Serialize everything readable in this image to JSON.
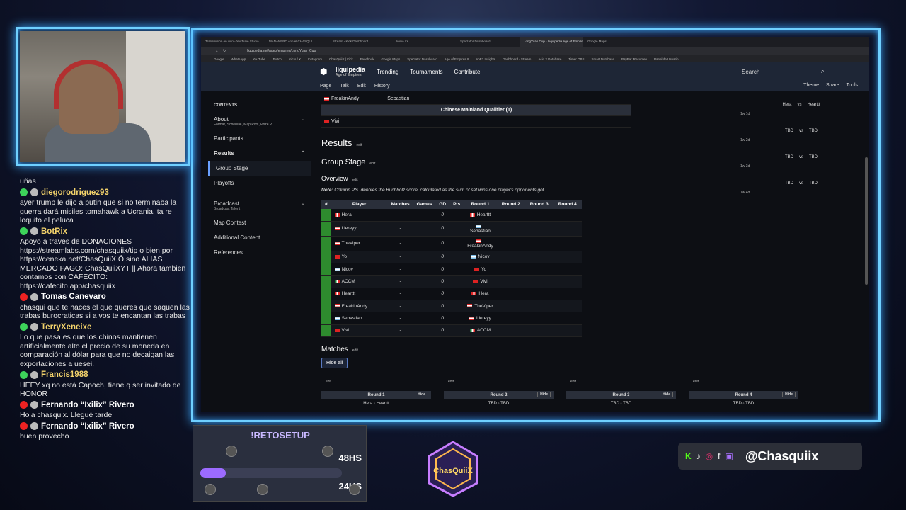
{
  "browser": {
    "tabs": [
      "Transmisión en vivo - YouTube Studio",
      "MAÑANERO con el CHASQUI",
      "Stream - Kick Dashboard",
      "Inicio / X",
      "Spectator Dashboard",
      "LongYuan Cup - Liquipedia Age of Empires",
      "Google Maps"
    ],
    "url": "liquipedia.net/ageofempires/LongYuan_Cup",
    "bookmarks": [
      "Google",
      "WhatsApp",
      "YouTube",
      "Twitch",
      "Inicio / X",
      "Instagram",
      "ChasQuiiX | Kick",
      "Facebook",
      "Google Maps",
      "Spectator Dashboard",
      "Age of Empires II",
      "AoE2 Insights",
      "Dashboard / Stream",
      "Acid 2 Database",
      "Timer OBS",
      "Smart Database",
      "PayPal: Resumen",
      "Panel de Usuario"
    ]
  },
  "liquipedia": {
    "logo": "liquipedia",
    "subtitle": "Age of Empires",
    "menu": [
      "Trending",
      "Tournaments",
      "Contribute"
    ],
    "search": "Search",
    "subnav": [
      "Page",
      "Talk",
      "Edit",
      "History"
    ],
    "subnav_right": [
      "Theme",
      "Share",
      "Tools"
    ]
  },
  "sidebar": {
    "contents": "CONTENTS",
    "about": "About",
    "about_sub": "Format, Schedule, Map Pool, Prize P...",
    "participants": "Participants",
    "results": "Results",
    "group_stage": "Group Stage",
    "playoffs": "Playoffs",
    "broadcast": "Broadcast",
    "broadcast_sub": "Broadcast Talent",
    "map_contest": "Map Contest",
    "additional": "Additional Content",
    "references": "References"
  },
  "qualifier": {
    "row1_player": "FreakinAndy",
    "row1_opp": "Sebastian",
    "title": "Chinese Mainland Qualifier (1)",
    "row2_player": "Vivi"
  },
  "main": {
    "results": "Results",
    "edit": "edit",
    "group_stage": "Group Stage",
    "overview": "Overview",
    "note_bold": "Note:",
    "note_text": " Column Pts. denotes the Buchholz score, calculated as the sum of set wins one player's opponents got.",
    "table_headers": [
      "#",
      "Player",
      "Matches",
      "Games",
      "GD",
      "Pts",
      "Round 1",
      "Round 2",
      "Round 3",
      "Round 4"
    ],
    "matches": "Matches",
    "hide_all": "Hide all"
  },
  "standings": [
    {
      "player": "Hera",
      "flag": "f-pe",
      "matches": "-",
      "gd": "0",
      "r1": "Hearttt",
      "r1flag": "f-pe"
    },
    {
      "player": "Liereyy",
      "flag": "f-at",
      "matches": "-",
      "gd": "0",
      "r1": "Sebastian",
      "r1flag": "f-ar"
    },
    {
      "player": "TheViper",
      "flag": "f-at",
      "matches": "-",
      "gd": "0",
      "r1": "FreakinAndy",
      "r1flag": "f-at"
    },
    {
      "player": "Yo",
      "flag": "f-cn",
      "matches": "-",
      "gd": "0",
      "r1": "Nicov",
      "r1flag": "f-ar"
    },
    {
      "player": "Nicov",
      "flag": "f-ar",
      "matches": "-",
      "gd": "0",
      "r1": "Yo",
      "r1flag": "f-cn"
    },
    {
      "player": "ACCM",
      "flag": "f-mx",
      "matches": "-",
      "gd": "0",
      "r1": "Vivi",
      "r1flag": "f-cn"
    },
    {
      "player": "Hearttt",
      "flag": "f-pe",
      "matches": "-",
      "gd": "0",
      "r1": "Hera",
      "r1flag": "f-pe"
    },
    {
      "player": "FreakinAndy",
      "flag": "f-at",
      "matches": "-",
      "gd": "0",
      "r1": "TheViper",
      "r1flag": "f-at"
    },
    {
      "player": "Sebastian",
      "flag": "f-ar",
      "matches": "-",
      "gd": "0",
      "r1": "Liereyy",
      "r1flag": "f-at"
    },
    {
      "player": "Vivi",
      "flag": "f-cn",
      "matches": "-",
      "gd": "0",
      "r1": "ACCM",
      "r1flag": "f-mx"
    }
  ],
  "rounds": [
    {
      "title": "Round 1",
      "hide": "Hide",
      "left": "Hera",
      "right": "Hearttt"
    },
    {
      "title": "Round 2",
      "hide": "Hide",
      "left": "TBD",
      "right": "TBD"
    },
    {
      "title": "Round 3",
      "hide": "Hide",
      "left": "TBD",
      "right": "TBD"
    },
    {
      "title": "Round 4",
      "hide": "Hide",
      "left": "TBD",
      "right": "TBD"
    }
  ],
  "right_panel": [
    {
      "left": "Hera",
      "vs": "vs",
      "right": "Hearttt",
      "time": "1w 1d"
    },
    {
      "left": "TBD",
      "vs": "vs",
      "right": "TBD",
      "time": "1w 2d"
    },
    {
      "left": "TBD",
      "vs": "vs",
      "right": "TBD",
      "time": "1w 3d"
    },
    {
      "left": "TBD",
      "vs": "vs",
      "right": "TBD",
      "time": "1w 4d"
    }
  ],
  "chat": [
    {
      "type": "text",
      "text": "uñas"
    },
    {
      "type": "user",
      "badge": "b-green",
      "name": "diegorodriguez93"
    },
    {
      "type": "text",
      "text": "ayer trump le dijo a putin que si no terminaba la guerra dará misiles tomahawk a Ucrania, ta re loquito el peluca"
    },
    {
      "type": "user",
      "badge": "b-green",
      "name": "BotRix"
    },
    {
      "type": "text",
      "text": "Apoyo a traves de DONACIONES https://streamlabs.com/chasquiix/tip o bien por https://ceneka.net/ChasQuiiX Ó sino ALIAS MERCADO PAGO: ChasQuiiXYT || Ahora tambien contamos con CAFECITO: https://cafecito.app/chasquiix"
    },
    {
      "type": "user",
      "badge": "b-red",
      "name": "Tomas Canevaro"
    },
    {
      "type": "text",
      "text": "chasqui que te haces el que queres que saquen las trabas burocraticas si a vos te encantan las trabas"
    },
    {
      "type": "user",
      "badge": "b-green",
      "name": "TerryXeneixe"
    },
    {
      "type": "text",
      "text": "Lo que pasa es que los chinos mantienen artificialmente alto el precio de su moneda en comparación al dólar para que no decaigan las exportaciones a uesei."
    },
    {
      "type": "user",
      "badge": "b-green",
      "name": "Francis1988"
    },
    {
      "type": "text",
      "text": "HEEY xq no está Capoch, tiene q ser invitado de HONOR"
    },
    {
      "type": "user",
      "badge": "b-red",
      "name": "Fernando “Ixilix” Rivero"
    },
    {
      "type": "text",
      "text": "Hola chasquix. Llegué tarde"
    },
    {
      "type": "user",
      "badge": "b-red",
      "name": "Fernando “Ixilix” Rivero"
    },
    {
      "type": "text",
      "text": "buen provecho"
    }
  ],
  "overlay": {
    "reto": "!RETOSETUP",
    "hs48": "48HS",
    "hs24": "24HS",
    "logo_text": "ChasQuiiX",
    "handle": "@Chasquiix",
    "progress": 0.18,
    "colors": {
      "neon": "#6fd0ff",
      "accent": "#9c6bff"
    }
  }
}
